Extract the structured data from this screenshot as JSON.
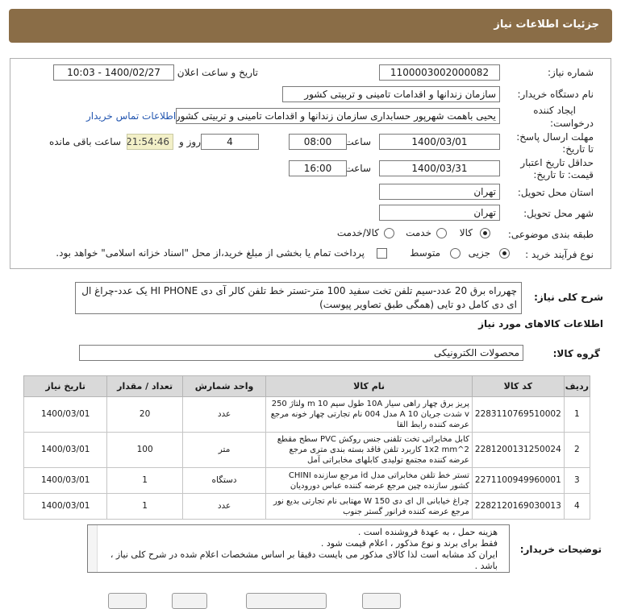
{
  "header": {
    "title": "جزئیات اطلاعات نیاز"
  },
  "form": {
    "need_number_label": "شماره نیاز:",
    "need_number": "1100003002000082",
    "announce_label": "تاریخ و ساعت اعلان عمومی:",
    "announce_value": "1400/02/27 - 10:03",
    "buyer_org_label": "نام دستگاه خریدار:",
    "buyer_org": "سازمان زندانها و اقدامات تامینی و تربیتی کشور",
    "creator_label_1": "ایجاد کننده",
    "creator_label_2": "درخواست:",
    "creator_value": "یحیی باهمت شهرپور حسابداری سازمان زندانها و اقدامات تامینی و تربیتی کشور",
    "contact_link": "اطلاعات تماس خریدار",
    "reply_deadline_label_1": "مهلت ارسال پاسخ:",
    "reply_deadline_label_2": "تا تاریخ:",
    "reply_date": "1400/03/01",
    "time_label": "ساعت",
    "reply_time": "08:00",
    "days_value": "4",
    "days_label": "روز و",
    "remaining_time": "21:54:46",
    "remaining_label": "ساعت باقی مانده",
    "validity_label_1": "حداقل تاریخ اعتبار",
    "validity_label_2": "قیمت: تا تاریخ:",
    "validity_date": "1400/03/31",
    "validity_time_label": "ساعت",
    "validity_time": "16:00",
    "province_label": "استان محل تحویل:",
    "province": "تهران",
    "city_label": "شهر محل تحویل:",
    "city": "تهران",
    "category_label": "طبقه بندی موضوعی:",
    "category_options": [
      "کالا",
      "خدمت",
      "کالا/خدمت"
    ],
    "process_label": "نوع فرآیند خرید :",
    "process_options": [
      "جزیی",
      "متوسط"
    ],
    "payment_note": "پرداخت تمام یا بخشی از مبلغ خرید،از محل \"اسناد خزانه اسلامی\" خواهد بود."
  },
  "description": {
    "label": "شرح کلی نیاز:",
    "text": "چهرراه برق 20 عدد-سیم تلفن تخت سفید 100 متر-تستر خط تلفن کالر آی دی HI PHONE یک عدد-چراغ ال ای دی کامل دو تایی (همگی طبق تصاویر پیوست)"
  },
  "goods": {
    "section_title": "اطلاعات کالاهای مورد نیاز",
    "group_label": "گروه کالا:",
    "group_value": "محصولات الکترونیکی",
    "columns": [
      "ردیف",
      "کد کالا",
      "نام کالا",
      "واحد شمارش",
      "تعداد / مقدار",
      "تاریخ نیاز"
    ],
    "rows": [
      {
        "idx": "1",
        "code": "2283110769510002",
        "name": "پریز برق چهار راهی سیار 10A طول سیم 10 m ولتاژ 250 v شدت جریان 10 A مدل 004 نام تجارتی چهار خونه مرجع عرضه کننده رابط القا",
        "unit": "عدد",
        "qty": "20",
        "date": "1400/03/01"
      },
      {
        "idx": "2",
        "code": "2281200131250024",
        "name": "کابل مخابراتی تخت تلفنی جنس روکش PVC سطح مقطع 1x2 mm^2 کاربرد تلفن فاقد بسته بندی متری مرجع عرضه کننده مجتمع تولیدی کابلهای مخابراتی آمل",
        "unit": "متر",
        "qty": "100",
        "date": "1400/03/01"
      },
      {
        "idx": "3",
        "code": "2271100949960001",
        "name": "تستر خط تلفن مخابراتی مدل id مرجع سازنده CHINI کشور سازنده چین مرجع عرضه کننده عباس دوروديان",
        "unit": "دستگاه",
        "qty": "1",
        "date": "1400/03/01"
      },
      {
        "idx": "4",
        "code": "2282120169030013",
        "name": "چراغ خیابانی ال ای دی 150 W مهتابی نام تجارتی بدیع نور مرجع عرضه کننده فرانور گستر جنوب",
        "unit": "عدد",
        "qty": "1",
        "date": "1400/03/01"
      }
    ]
  },
  "notes": {
    "label": "توضیحات خریدار:",
    "lines": [
      "هزینه حمل ، به عهدۀ فروشنده است .",
      "فقط برای برند و نوع  مذکور ، اعلام قیمت شود .",
      "ایران کد مشابه  است لذا کالای مذکور می بایست دقیقا بر اساس مشخصات اعلام شده  در شرح کلی نیاز ، باشد ."
    ]
  },
  "colors": {
    "header_bg": "#8a6d47",
    "table_header_bg": "#d9d9d9",
    "link": "#2356b0",
    "remaining_bg": "#f3f0c8"
  }
}
